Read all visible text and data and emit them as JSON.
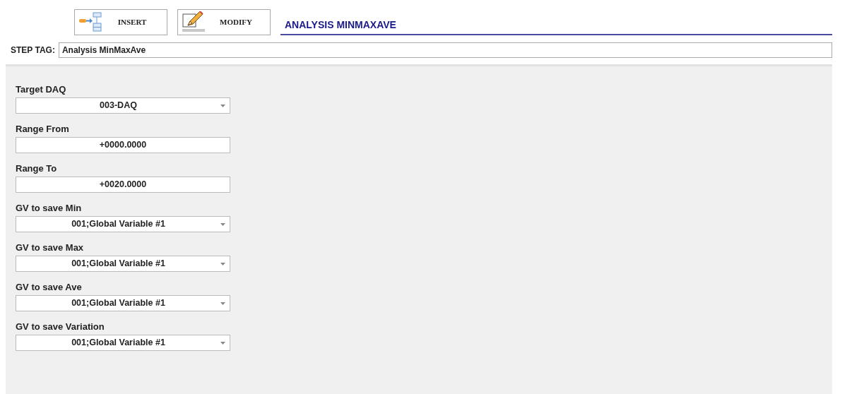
{
  "toolbar": {
    "buttons": [
      {
        "label": "INSERT",
        "kind": "insert"
      },
      {
        "label": "MODIFY",
        "kind": "modify"
      }
    ],
    "title": "ANALYSIS MINMAXAVE"
  },
  "step_tag": {
    "label": "STEP TAG:",
    "value": "Analysis MinMaxAve"
  },
  "fields": [
    {
      "label": "Target DAQ",
      "kind": "select",
      "value": "003-DAQ"
    },
    {
      "label": "Range From",
      "kind": "text",
      "value": "+0000.0000"
    },
    {
      "label": "Range To",
      "kind": "text",
      "value": "+0020.0000"
    },
    {
      "label": "GV to save Min",
      "kind": "select",
      "value": "001;Global Variable #1"
    },
    {
      "label": "GV to save Max",
      "kind": "select",
      "value": "001;Global Variable #1"
    },
    {
      "label": "GV to save Ave",
      "kind": "select",
      "value": "001;Global Variable #1"
    },
    {
      "label": "GV to save Variation",
      "kind": "select",
      "value": "001;Global Variable #1"
    }
  ]
}
